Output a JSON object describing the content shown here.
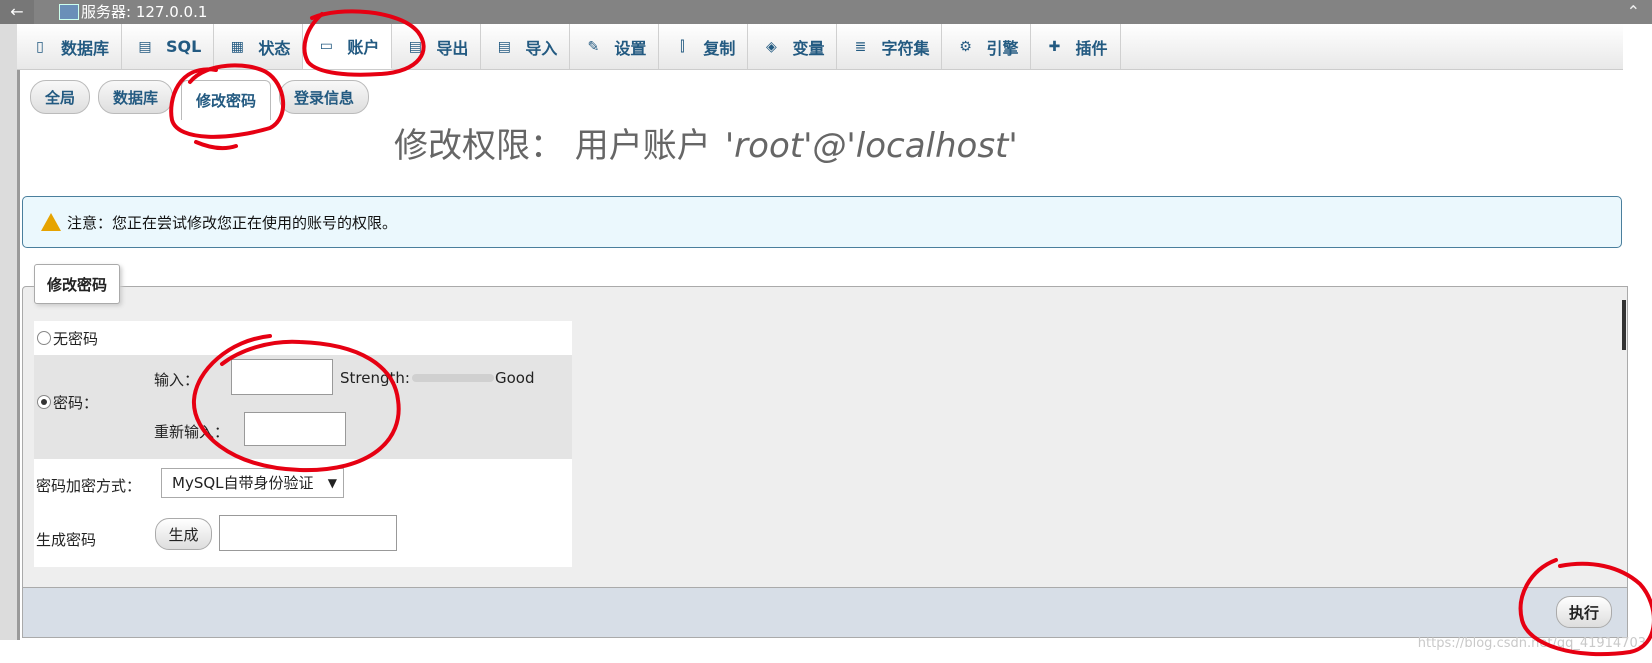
{
  "titlebar": {
    "back": "←",
    "title": "服务器: 127.0.0.1",
    "collapse": "⌃"
  },
  "topnav": [
    {
      "label": "数据库",
      "icon": "database-icon",
      "glyph": "▯"
    },
    {
      "label": "SQL",
      "icon": "sql-icon",
      "glyph": "▤"
    },
    {
      "label": "状态",
      "icon": "status-icon",
      "glyph": "▦"
    },
    {
      "label": "账户",
      "icon": "accounts-icon",
      "glyph": "▭",
      "active": true
    },
    {
      "label": "导出",
      "icon": "export-icon",
      "glyph": "▤"
    },
    {
      "label": "导入",
      "icon": "import-icon",
      "glyph": "▤"
    },
    {
      "label": "设置",
      "icon": "wrench-icon",
      "glyph": "✎"
    },
    {
      "label": "复制",
      "icon": "replication-icon",
      "glyph": "⫿"
    },
    {
      "label": "变量",
      "icon": "variables-icon",
      "glyph": "◈"
    },
    {
      "label": "字符集",
      "icon": "charset-icon",
      "glyph": "≣"
    },
    {
      "label": "引擎",
      "icon": "engine-icon",
      "glyph": "⚙"
    },
    {
      "label": "插件",
      "icon": "plugin-icon",
      "glyph": "✚"
    }
  ],
  "subtabs": [
    {
      "label": "全局"
    },
    {
      "label": "数据库"
    },
    {
      "label": "修改密码",
      "active": true
    },
    {
      "label": "登录信息"
    }
  ],
  "page": {
    "heading": "修改权限：  用户账户",
    "account": "'root'@'localhost'"
  },
  "notice": "注意：您正在尝试修改您正在使用的账号的权限。",
  "form": {
    "legend": "修改密码",
    "no_password": "无密码",
    "password": "密码：",
    "enter": "输入：",
    "strength_label": "Strength:",
    "strength_value": "Good",
    "reenter": "重新输入：",
    "hashing_label": "密码加密方式：",
    "hashing_value": "MySQL自带身份验证",
    "generate_label": "生成密码",
    "generate_button": "生成"
  },
  "execute_button": "执行",
  "watermark": "https://blog.csdn.net/qq_41914703",
  "colors": {
    "annotation": "#e60012",
    "link": "#235a81"
  }
}
